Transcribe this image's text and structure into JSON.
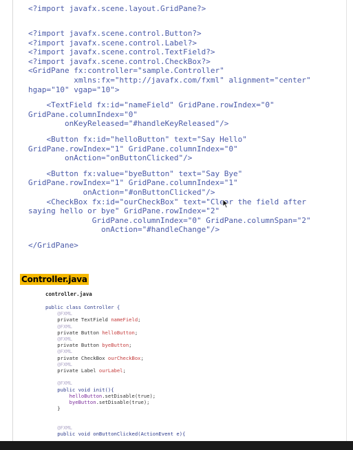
{
  "fxml_lines": [
    "<?import javafx.scene.layout.GridPane?>",
    "",
    "<?import javafx.scene.control.Button?>",
    "<?import javafx.scene.control.Label?>",
    "<?import javafx.scene.control.TextField?>",
    "<?import javafx.scene.control.CheckBox?>",
    "<GridPane fx:controller=\"sample.Controller\"",
    "          xmlns:fx=\"http://javafx.com/fxml\" alignment=\"center\"",
    "hgap=\"10\" vgap=\"10\">",
    "",
    "    <TextField fx:id=\"nameField\" GridPane.rowIndex=\"0\"",
    "GridPane.columnIndex=\"0\"",
    "        onKeyReleased=\"#handleKeyReleased\"/>",
    "",
    "    <Button fx:id=\"helloButton\" text=\"Say Hello\"",
    "GridPane.rowIndex=\"1\" GridPane.columnIndex=\"0\"",
    "        onAction=\"onButtonClicked\"/>",
    "",
    "    <Button fx:value=\"byeButton\" text=\"Say Bye\"",
    "GridPane.rowIndex=\"1\" GridPane.columnIndex=\"1\"",
    "            onAction=\"#onButtonClicked\"/>",
    "    <CheckBox fx:id=\"ourCheckBox\" text=\"Clear the field after",
    "saying hello or bye\" GridPane.rowIndex=\"2\"",
    "              GridPane.columnIndex=\"0\" GridPane.columnSpan=\"2\"",
    "                onAction=\"#handleChange\"/>",
    "",
    "</GridPane>"
  ],
  "section_title": "Controller.java",
  "file_label": "controller.java",
  "java_lines": [
    [
      {
        "t": "public class Controller {",
        "c": "kw"
      }
    ],
    [
      {
        "t": "    @FXML",
        "c": "ann"
      }
    ],
    [
      {
        "t": "    private TextField ",
        "c": ""
      },
      {
        "t": "nameField",
        "c": "fld"
      },
      {
        "t": ";",
        "c": ""
      }
    ],
    [
      {
        "t": "    @FXML",
        "c": "ann"
      }
    ],
    [
      {
        "t": "    private Button ",
        "c": ""
      },
      {
        "t": "helloButton",
        "c": "fld"
      },
      {
        "t": ";",
        "c": ""
      }
    ],
    [
      {
        "t": "    @FXML",
        "c": "ann"
      }
    ],
    [
      {
        "t": "    private Button ",
        "c": ""
      },
      {
        "t": "byeButton",
        "c": "fld"
      },
      {
        "t": ";",
        "c": ""
      }
    ],
    [
      {
        "t": "    @FXML",
        "c": "ann"
      }
    ],
    [
      {
        "t": "    private CheckBox ",
        "c": ""
      },
      {
        "t": "ourCheckBox",
        "c": "fld"
      },
      {
        "t": ";",
        "c": ""
      }
    ],
    [
      {
        "t": "    @FXML",
        "c": "ann"
      }
    ],
    [
      {
        "t": "    private Label ",
        "c": ""
      },
      {
        "t": "ourLabel",
        "c": "fld"
      },
      {
        "t": ";",
        "c": ""
      }
    ],
    [
      {
        "t": "",
        "c": ""
      }
    ],
    [
      {
        "t": "    @FXML",
        "c": "ann"
      }
    ],
    [
      {
        "t": "    public void init(){",
        "c": "kw"
      }
    ],
    [
      {
        "t": "        helloButton",
        "c": "meth"
      },
      {
        "t": ".setDisable(true);",
        "c": ""
      }
    ],
    [
      {
        "t": "        byeButton",
        "c": "meth"
      },
      {
        "t": ".setDisable(true);",
        "c": ""
      }
    ],
    [
      {
        "t": "    }",
        "c": ""
      }
    ],
    [
      {
        "t": "",
        "c": ""
      }
    ],
    [
      {
        "t": "",
        "c": ""
      }
    ],
    [
      {
        "t": "    @FXML",
        "c": "ann"
      }
    ],
    [
      {
        "t": "    public void onButtonClicked(ActionEvent e){",
        "c": "kw"
      }
    ]
  ]
}
